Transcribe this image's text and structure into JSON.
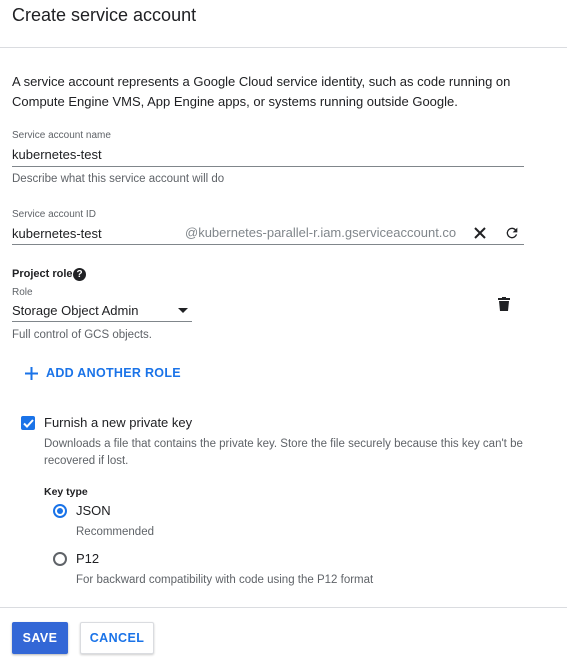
{
  "page": {
    "title": "Create service account",
    "intro": "A service account represents a Google Cloud service identity, such as code running on Compute Engine VMS, App Engine apps, or systems running outside Google."
  },
  "service_account_name": {
    "label": "Service account name",
    "value": "kubernetes-test",
    "hint": "Describe what this service account will do"
  },
  "service_account_id": {
    "label": "Service account ID",
    "value": "kubernetes-test",
    "suffix": "@kubernetes-parallel-r.iam.gserviceaccount.co",
    "clear_icon": "close-icon",
    "refresh_icon": "refresh-icon"
  },
  "project_role": {
    "label": "Project role",
    "help_glyph": "?",
    "role_label": "Role",
    "role_value": "Storage Object Admin",
    "role_hint": "Full control of GCS objects.",
    "delete_icon": "trash-icon",
    "add_role_label": "ADD ANOTHER ROLE"
  },
  "private_key": {
    "checkbox_label": "Furnish a new private key",
    "checked": true,
    "hint": "Downloads a file that contains the private key. Store the file securely because this key can't be recovered if lost.",
    "key_type_label": "Key type",
    "options": [
      {
        "label": "JSON",
        "hint": "Recommended",
        "selected": true
      },
      {
        "label": "P12",
        "hint": "For backward compatibility with code using the P12 format",
        "selected": false
      }
    ]
  },
  "footer": {
    "save_label": "SAVE",
    "cancel_label": "CANCEL"
  },
  "colors": {
    "accent": "#1a73e8",
    "primary_button": "#3367d6"
  }
}
